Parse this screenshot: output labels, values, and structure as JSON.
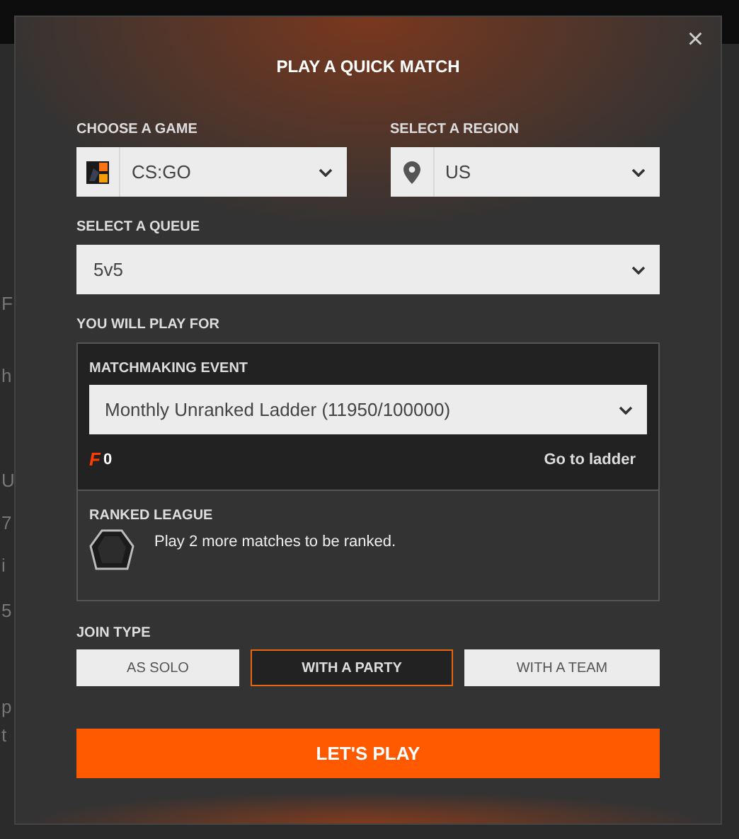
{
  "background_fragments": [
    "F",
    "h",
    "U",
    "7",
    "i",
    "5",
    "p",
    "t"
  ],
  "dialog": {
    "title": "PLAY A QUICK MATCH",
    "close": "×"
  },
  "game": {
    "label": "CHOOSE A GAME",
    "value": "CS:GO"
  },
  "region": {
    "label": "SELECT A REGION",
    "value": "US"
  },
  "queue": {
    "label": "SELECT A QUEUE",
    "value": "5v5"
  },
  "play_for": {
    "label": "YOU WILL PLAY FOR",
    "event_label": "MATCHMAKING EVENT",
    "event_value": "Monthly Unranked Ladder (11950/100000)",
    "points_mark": "F",
    "points": "0",
    "ladder_link": "Go to ladder",
    "league_label": "RANKED LEAGUE",
    "league_message": "Play 2 more matches to be ranked."
  },
  "join_type": {
    "label": "JOIN TYPE",
    "options": [
      {
        "label": "AS SOLO",
        "selected": false
      },
      {
        "label": "WITH A PARTY",
        "selected": true
      },
      {
        "label": "WITH A TEAM",
        "selected": false
      }
    ]
  },
  "play_button": "LET'S PLAY"
}
